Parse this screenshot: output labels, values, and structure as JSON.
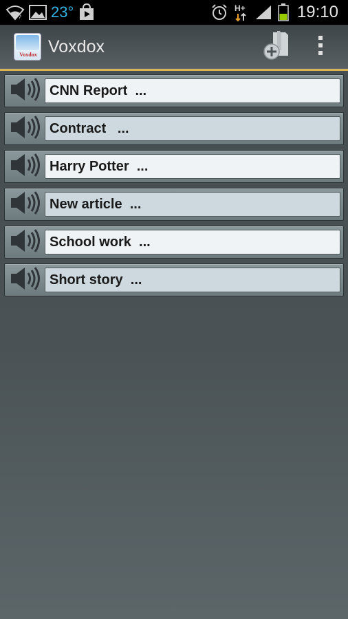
{
  "status_bar": {
    "temperature": "23°",
    "time": "19:10",
    "icons": [
      "wifi-icon",
      "gallery-icon",
      "play-store-icon",
      "alarm-icon",
      "hplus-data-icon",
      "signal-icon",
      "battery-icon"
    ],
    "temp_color": "#33b5e5"
  },
  "action_bar": {
    "title": "Voxdox",
    "logo_text": "Voxdox",
    "actions": [
      "add-document-icon",
      "overflow-menu-icon"
    ],
    "accent_color": "#d9b55a"
  },
  "documents": [
    {
      "label": "CNN Report  ..."
    },
    {
      "label": "Contract   ..."
    },
    {
      "label": "Harry Potter  ..."
    },
    {
      "label": "New article  ..."
    },
    {
      "label": "School work  ..."
    },
    {
      "label": "Short story  ..."
    }
  ]
}
